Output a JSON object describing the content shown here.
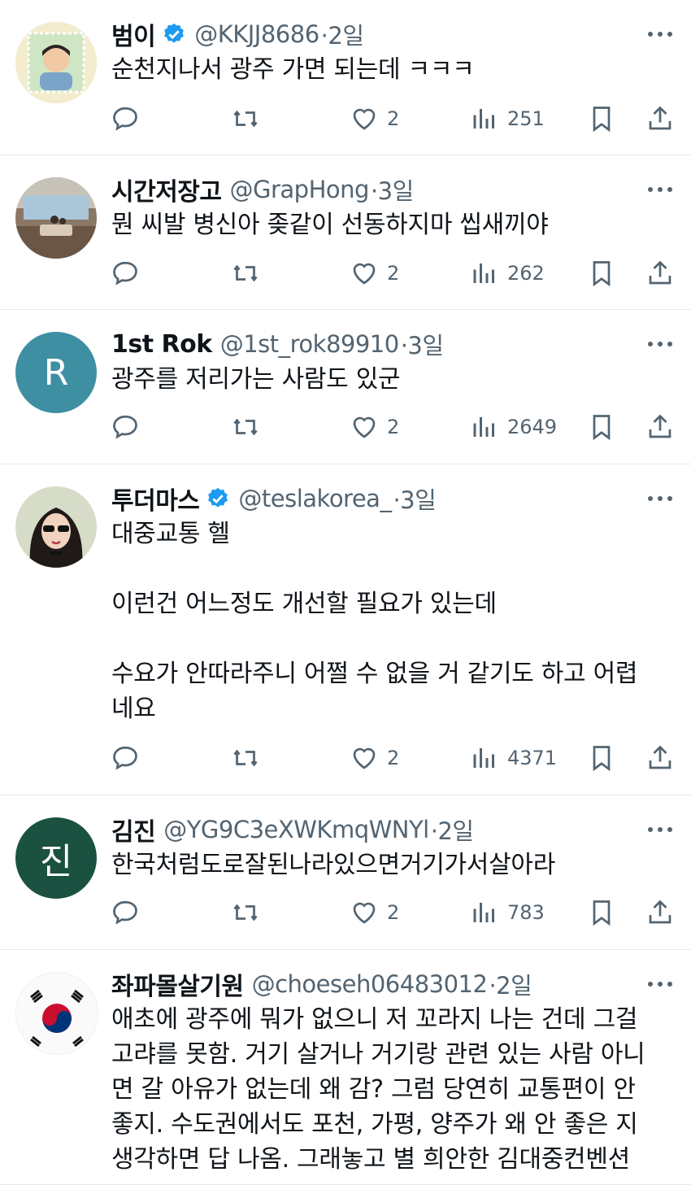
{
  "tweets": [
    {
      "name": "범이",
      "verified": true,
      "handle": "@KKJJ8686",
      "time": "·2일",
      "lines": [
        "순천지나서 광주 가면 되는데 ㅋㅋㅋ"
      ],
      "replies": "",
      "retweets": "",
      "likes": "2",
      "views": "251",
      "avatar": "boy-photo-avatar"
    },
    {
      "name": "시간저장고",
      "verified": false,
      "handle": "@GrapHong",
      "time": "·3일",
      "lines": [
        "뭔 씨발 병신아 좆같이 선동하지마 씹새끼야"
      ],
      "replies": "",
      "retweets": "",
      "likes": "2",
      "views": "262",
      "avatar": "living-room-photo-avatar"
    },
    {
      "name": "1st Rok",
      "verified": false,
      "handle": "@1st_rok89910",
      "time": "·3일",
      "lines": [
        "광주를 저리가는 사람도 있군"
      ],
      "replies": "",
      "retweets": "",
      "likes": "2",
      "views": "2649",
      "avatar_letter": "R",
      "avatar_color": "#3f8fa3"
    },
    {
      "name": "투더마스",
      "verified": true,
      "handle": "@teslakorea_",
      "time": "·3일",
      "lines": [
        "대중교통 헬",
        "",
        "이런건 어느정도 개선할 필요가 있는데",
        "",
        "수요가 안따라주니 어쩔 수 없을 거 같기도 하고 어렵",
        "네요"
      ],
      "replies": "",
      "retweets": "",
      "likes": "2",
      "views": "4371",
      "avatar": "woman-illustration-avatar"
    },
    {
      "name": "김진",
      "verified": false,
      "handle": "@YG9C3eXWKmqWNYl",
      "time": "·2일",
      "lines": [
        "한국처럼도로잘된나라있으면거기가서살아라"
      ],
      "replies": "",
      "retweets": "",
      "likes": "2",
      "views": "783",
      "avatar_letter": "진",
      "avatar_color": "#1b5140"
    },
    {
      "name": "좌파몰살기원",
      "verified": false,
      "handle": "@choeseh06483012",
      "time": "·2일",
      "lines": [
        "애초에 광주에 뭐가 없으니 저 꼬라지 나는 건데 그걸",
        "고랴를 못함. 거기 살거나 거기랑 관련 있는 사람 아니",
        "면 갈 아유가 없는데 왜 감? 그럼 당연히 교통편이 안",
        "좋지. 수도권에서도 포천, 가평, 양주가 왜 안 좋은 지",
        "생각하면 답 나옴. 그래놓고 별 희안한 김대중컨벤션"
      ],
      "avatar": "korean-flag-avatar"
    }
  ],
  "colors": {
    "verified": "#1d9bf0",
    "muted": "#536471",
    "divider": "#e6e9ec"
  }
}
